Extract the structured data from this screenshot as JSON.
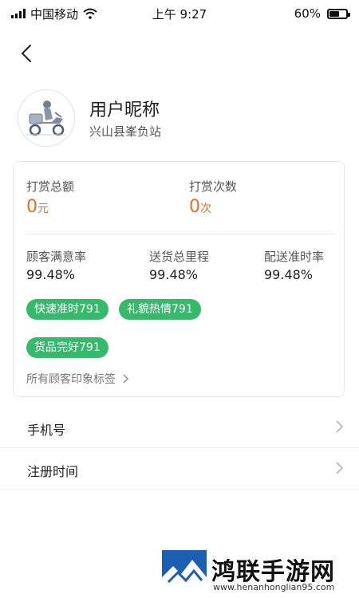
{
  "status_bar": {
    "carrier": "中国移动",
    "time": "上午 9:27",
    "battery_percent": "60%",
    "battery_level": 0.6
  },
  "profile": {
    "nickname": "用户昵称",
    "station": "兴山县峯负站"
  },
  "rewards": {
    "total_label": "打赏总额",
    "total_value": "0",
    "total_unit": "元",
    "count_label": "打赏次数",
    "count_value": "0",
    "count_unit": "次"
  },
  "metrics": [
    {
      "label": "顾客满意率",
      "value": "99.48%"
    },
    {
      "label": "送货总里程",
      "value": "99.48%"
    },
    {
      "label": "配送准时率",
      "value": "99.48%"
    }
  ],
  "tags": [
    "快速准时791",
    "礼貌热情791",
    "货品完好791"
  ],
  "all_tags_label": "所有顾客印象标签",
  "list": [
    {
      "label": "手机号"
    },
    {
      "label": "注册时间"
    }
  ],
  "watermark": {
    "title": "鸿联手游网",
    "url": "www.henanhonglian95.com"
  },
  "colors": {
    "accent_orange": "#e3702d",
    "tag_green": "#35b96a"
  },
  "icons": {
    "back": "chevron-left-icon",
    "wifi": "wifi-icon",
    "chevron": "chevron-right-icon",
    "avatar": "courier-scooter-icon"
  }
}
